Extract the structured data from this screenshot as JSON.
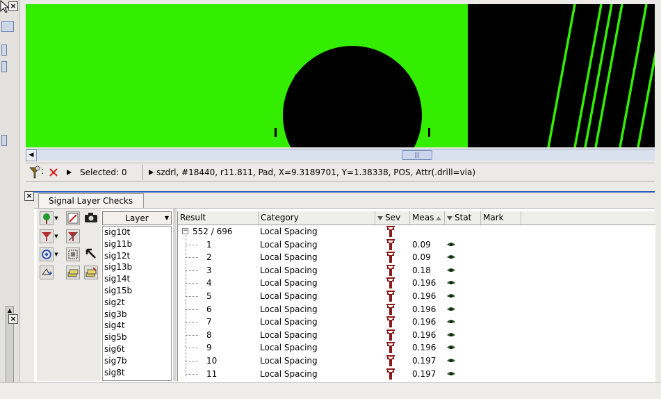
{
  "status_bar": {
    "selected": "Selected: 0",
    "feature_info": "szdrl, #18440, r11.811, Pad, X=9.3189701, Y=1.38338, POS, Attr(.drill=via)"
  },
  "panel": {
    "tab_label": "Signal Layer Checks",
    "layer_header": "Layer",
    "layers": [
      "sig10t",
      "sig11b",
      "sig12t",
      "sig13b",
      "sig14t",
      "sig15b",
      "sig2t",
      "sig3b",
      "sig4t",
      "sig5b",
      "sig6t",
      "sig7b",
      "sig8t"
    ]
  },
  "results": {
    "columns": [
      "Result",
      "Category",
      "Sev",
      "Meas",
      "Stat",
      "Mark"
    ],
    "group": {
      "label": "552 / 696",
      "category": "Local Spacing"
    },
    "rows": [
      {
        "id": "1",
        "category": "Local Spacing",
        "meas": "0.09"
      },
      {
        "id": "2",
        "category": "Local Spacing",
        "meas": "0.09"
      },
      {
        "id": "3",
        "category": "Local Spacing",
        "meas": "0.18"
      },
      {
        "id": "4",
        "category": "Local Spacing",
        "meas": "0.196"
      },
      {
        "id": "5",
        "category": "Local Spacing",
        "meas": "0.196"
      },
      {
        "id": "6",
        "category": "Local Spacing",
        "meas": "0.196"
      },
      {
        "id": "7",
        "category": "Local Spacing",
        "meas": "0.196"
      },
      {
        "id": "8",
        "category": "Local Spacing",
        "meas": "0.196"
      },
      {
        "id": "9",
        "category": "Local Spacing",
        "meas": "0.196"
      },
      {
        "id": "10",
        "category": "Local Spacing",
        "meas": "0.197"
      },
      {
        "id": "11",
        "category": "Local Spacing",
        "meas": "0.197"
      }
    ]
  },
  "colors": {
    "copper": "#33ee00",
    "background": "#000000",
    "severity_icon": "#8b1a1a",
    "accent_border": "#2e5bb8"
  },
  "icons": {
    "close": "close-icon",
    "filter": "funnel-icon",
    "severity": "severity-warning-icon",
    "stat": "eye-icon",
    "camera": "camera-icon",
    "pointer": "arrow-pointer-icon"
  }
}
